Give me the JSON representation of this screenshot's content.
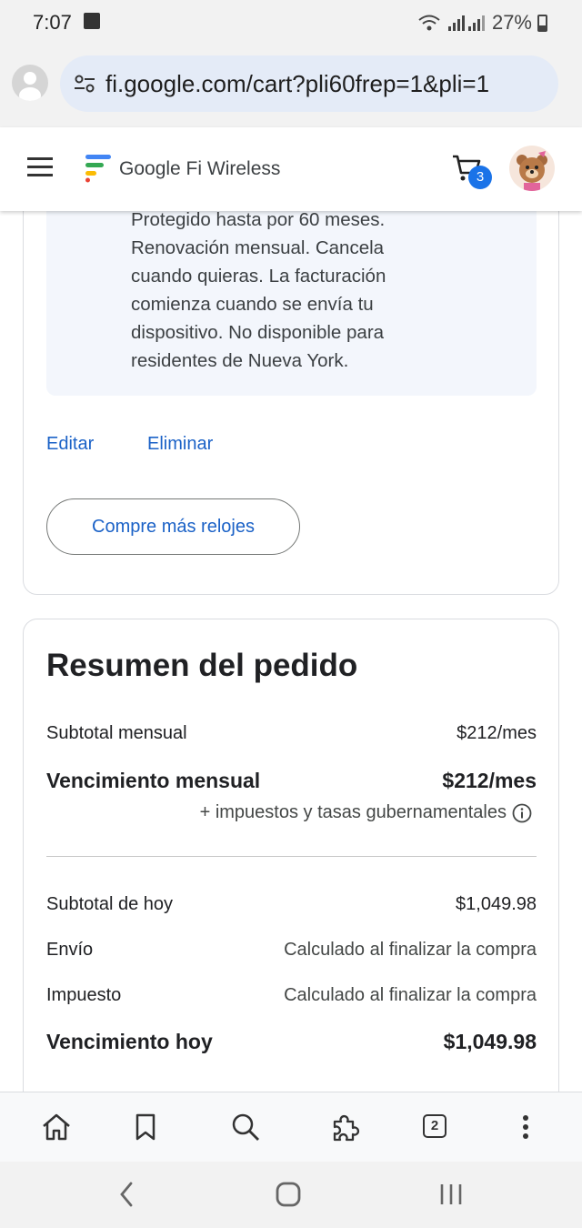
{
  "status_bar": {
    "time": "7:07",
    "battery": "27%"
  },
  "browser": {
    "url": "fi.google.com/cart?pli60frep=1&pli=1",
    "tab_count": "2"
  },
  "site": {
    "brand": "Google Fi Wireless",
    "cart_count": "3"
  },
  "product_card": {
    "description_lines": [
      "Protegido hasta por 60 meses.",
      "Renovación mensual. Cancela",
      "cuando quieras. La facturación",
      "comienza cuando se envía tu",
      "dispositivo. No disponible para",
      "residentes de Nueva York."
    ],
    "edit_label": "Editar",
    "remove_label": "Eliminar",
    "buy_more_label": "Compre más relojes"
  },
  "summary": {
    "title": "Resumen del pedido",
    "monthly_subtotal_label": "Subtotal mensual",
    "monthly_subtotal_value": "$212/mes",
    "monthly_due_label": "Vencimiento mensual",
    "monthly_due_value": "$212/mes",
    "tax_note": "+ impuestos y tasas gubernamentales",
    "today_subtotal_label": "Subtotal de hoy",
    "today_subtotal_value": "$1,049.98",
    "shipping_label": "Envío",
    "shipping_value": "Calculado al finalizar la compra",
    "tax_label": "Impuesto",
    "tax_value": "Calculado al finalizar la compra",
    "due_today_label": "Vencimiento hoy",
    "due_today_value": "$1,049.98"
  },
  "colors": {
    "link": "#1b62c7",
    "badge": "#1a73e8",
    "info_box": "#f3f6fc"
  }
}
